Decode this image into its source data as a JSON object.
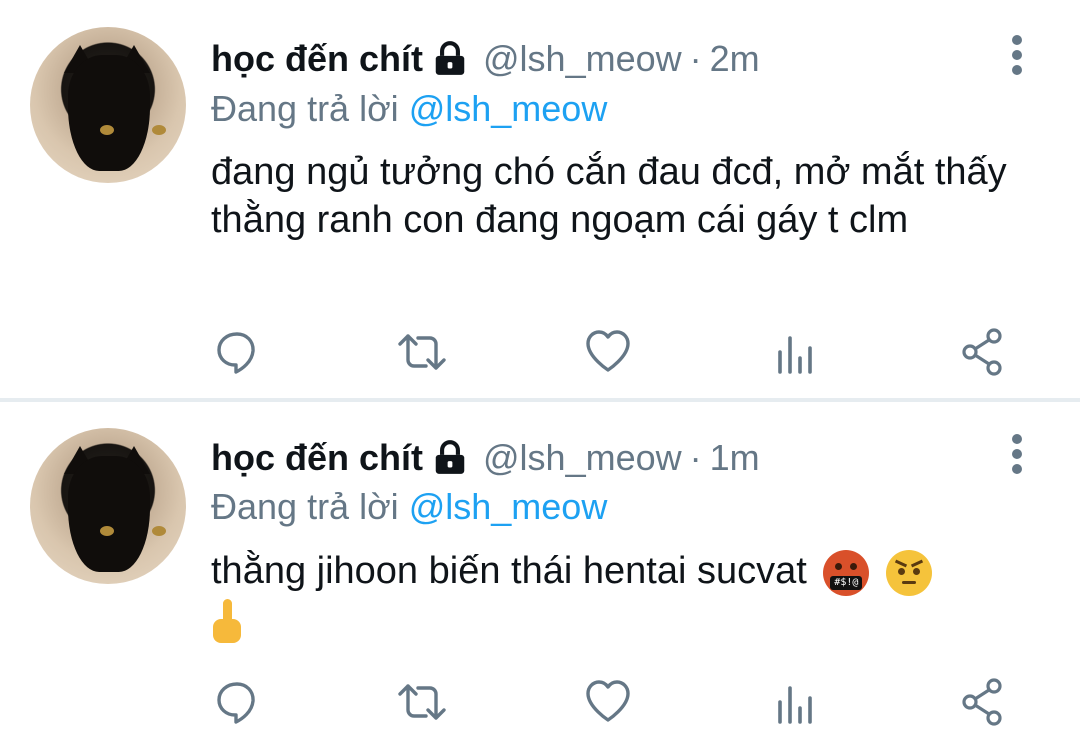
{
  "tweets": [
    {
      "name": "học đến chít",
      "handle": "@lsh_meow",
      "dot": "·",
      "time": "2m",
      "reply_prefix": "Đang trả lời",
      "reply_to": "@lsh_meow",
      "text": "đang ngủ tưởng chó cắn đau đcđ, mở mắt thấy thằng ranh con đang ngoạm cái gáy t clm",
      "emojis": []
    },
    {
      "name": "học đến chít",
      "handle": "@lsh_meow",
      "dot": "·",
      "time": "1m",
      "reply_prefix": "Đang trả lời",
      "reply_to": "@lsh_meow",
      "text": "thằng jihoon biến thái hentai sucvat",
      "emoji_mouth": "#$!@",
      "emojis": [
        "face-with-symbols-on-mouth",
        "angry-face",
        "middle-finger"
      ]
    }
  ],
  "icons": {
    "lock": "lock-icon",
    "more": "more-vertical-icon",
    "reply": "reply-icon",
    "retweet": "retweet-icon",
    "like": "heart-icon",
    "analytics": "analytics-icon",
    "share": "share-icon"
  },
  "colors": {
    "text": "#0f1419",
    "secondary": "#657786",
    "mention": "#1da1f2",
    "divider": "#e6ecf0"
  }
}
